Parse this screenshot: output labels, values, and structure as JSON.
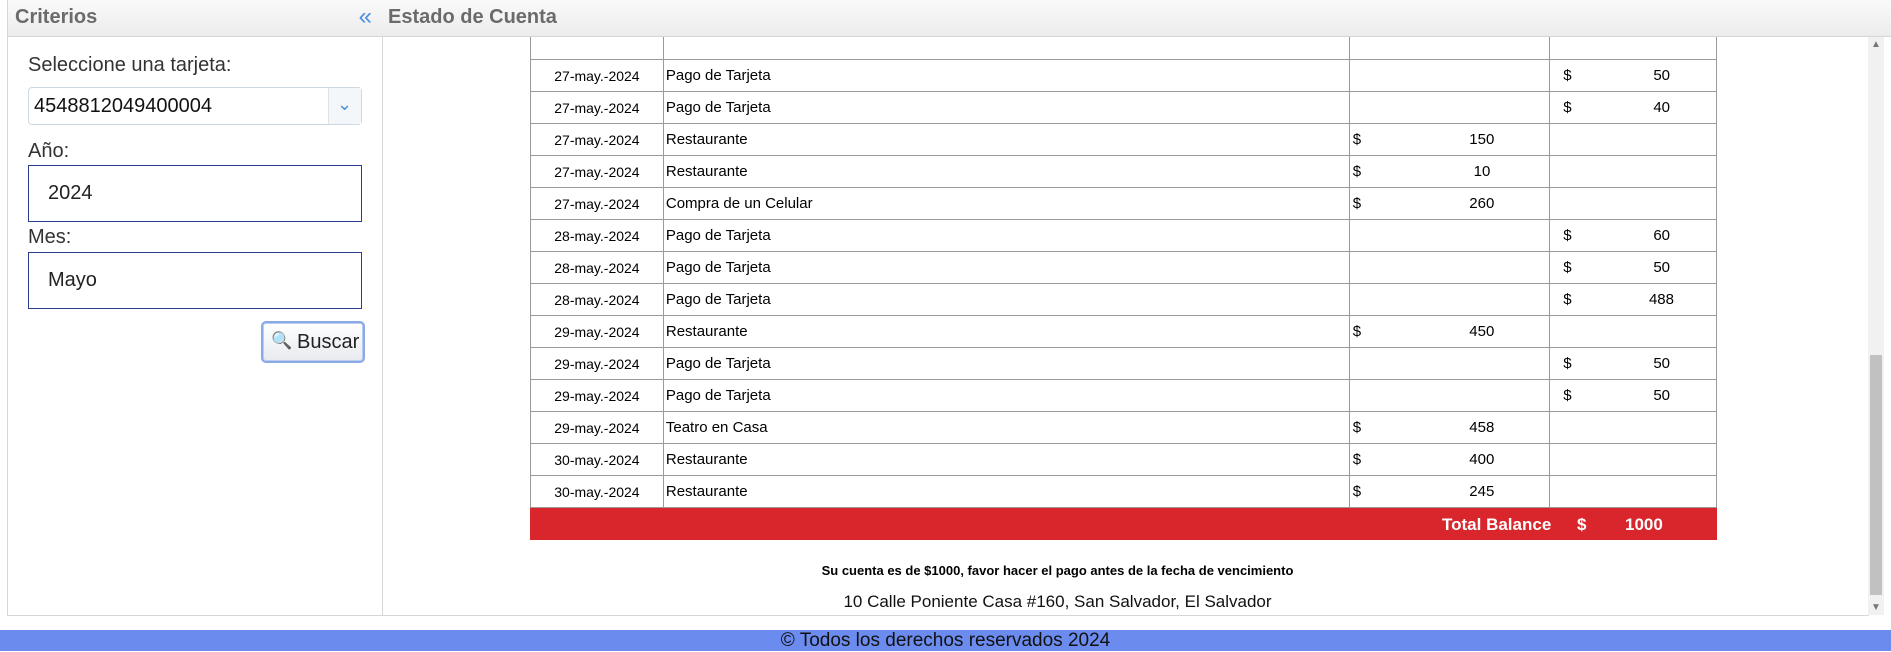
{
  "criteria": {
    "title": "Criterios",
    "card_label": "Seleccione una tarjeta:",
    "card_value": "4548812049400004",
    "year_label": "Año:",
    "year_value": "2024",
    "month_label": "Mes:",
    "month_value": "Mayo",
    "search_label": "Buscar"
  },
  "statement": {
    "title": "Estado de Cuenta",
    "currency": "$",
    "rows": [
      {
        "date": "27-may.-2024",
        "desc": "Pago de Tarjeta",
        "debit": "",
        "credit": "50"
      },
      {
        "date": "27-may.-2024",
        "desc": "Pago de Tarjeta",
        "debit": "",
        "credit": "40"
      },
      {
        "date": "27-may.-2024",
        "desc": "Restaurante",
        "debit": "150",
        "credit": ""
      },
      {
        "date": "27-may.-2024",
        "desc": "Restaurante",
        "debit": "10",
        "credit": ""
      },
      {
        "date": "27-may.-2024",
        "desc": "Compra de un Celular",
        "debit": "260",
        "credit": ""
      },
      {
        "date": "28-may.-2024",
        "desc": "Pago de Tarjeta",
        "debit": "",
        "credit": "60"
      },
      {
        "date": "28-may.-2024",
        "desc": "Pago de Tarjeta",
        "debit": "",
        "credit": "50"
      },
      {
        "date": "28-may.-2024",
        "desc": "Pago de Tarjeta",
        "debit": "",
        "credit": "488"
      },
      {
        "date": "29-may.-2024",
        "desc": "Restaurante",
        "debit": "450",
        "credit": ""
      },
      {
        "date": "29-may.-2024",
        "desc": "Pago de Tarjeta",
        "debit": "",
        "credit": "50"
      },
      {
        "date": "29-may.-2024",
        "desc": "Pago de Tarjeta",
        "debit": "",
        "credit": "50"
      },
      {
        "date": "29-may.-2024",
        "desc": "Teatro en Casa",
        "debit": "458",
        "credit": ""
      },
      {
        "date": "30-may.-2024",
        "desc": "Restaurante",
        "debit": "400",
        "credit": ""
      },
      {
        "date": "30-may.-2024",
        "desc": "Restaurante",
        "debit": "245",
        "credit": ""
      }
    ],
    "total_label": "Total Balance",
    "total_currency": "$",
    "total_value": "1000",
    "notice": "Su cuenta es de $1000, favor hacer el pago antes de la fecha de vencimiento",
    "address": "10 Calle Poniente Casa #160, San Salvador, El Salvador"
  },
  "footer": {
    "text": "© Todos los derechos reservados 2024"
  },
  "colors": {
    "total_bar": "#d9262d",
    "footer_bg": "#6b8cee",
    "accent": "#4a8fe0"
  },
  "icons": {
    "collapse": "double-chevron-left-icon",
    "select": "chevron-down-icon",
    "search": "magnifier-icon"
  }
}
